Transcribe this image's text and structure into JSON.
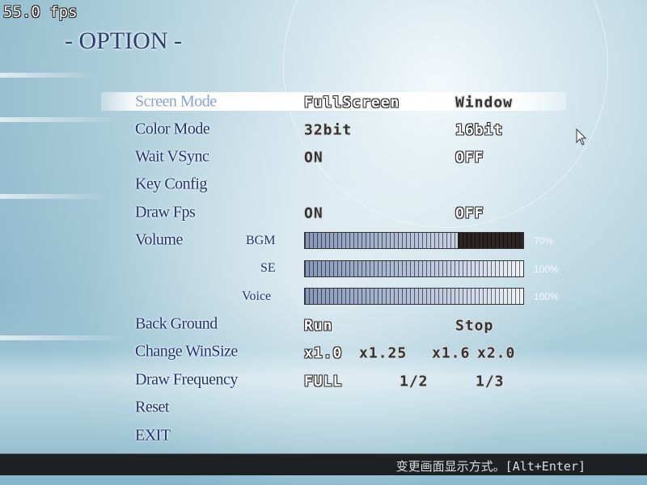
{
  "fps": "55.0 fps",
  "title": "- OPTION -",
  "menu": [
    {
      "label": "Screen Mode",
      "options": [
        "FullScreen",
        "Window"
      ],
      "selected": 0
    },
    {
      "label": "Color Mode",
      "options": [
        "32bit",
        "16bit"
      ],
      "selected": 1
    },
    {
      "label": "Wait VSync",
      "options": [
        "ON",
        "OFF"
      ],
      "selected": 1
    },
    {
      "label": "Key Config"
    },
    {
      "label": "Draw Fps",
      "options": [
        "ON",
        "OFF"
      ],
      "selected": 1
    },
    {
      "label": "Volume"
    },
    {
      "label": "Back Ground",
      "options": [
        "Run",
        "Stop"
      ],
      "selected": 0
    },
    {
      "label": "Change WinSize",
      "options": [
        "x1.0",
        "x1.25",
        "x1.6",
        "x2.0"
      ],
      "selected": 0
    },
    {
      "label": "Draw Frequency",
      "options": [
        "FULL",
        "1/2",
        "1/3"
      ],
      "selected": 0
    },
    {
      "label": "Reset"
    },
    {
      "label": "EXIT"
    }
  ],
  "volume": [
    {
      "label": "BGM",
      "value": 0.7,
      "text": "70%"
    },
    {
      "label": "SE",
      "value": 1.0,
      "text": "100%"
    },
    {
      "label": "Voice",
      "value": 1.0,
      "text": "100%"
    }
  ],
  "status": "变更画面显示方式。[Alt+Enter]",
  "colors": {
    "label": "#1f3570",
    "selected_label": "#8c9fd8",
    "status_bar": "#1d2124"
  }
}
